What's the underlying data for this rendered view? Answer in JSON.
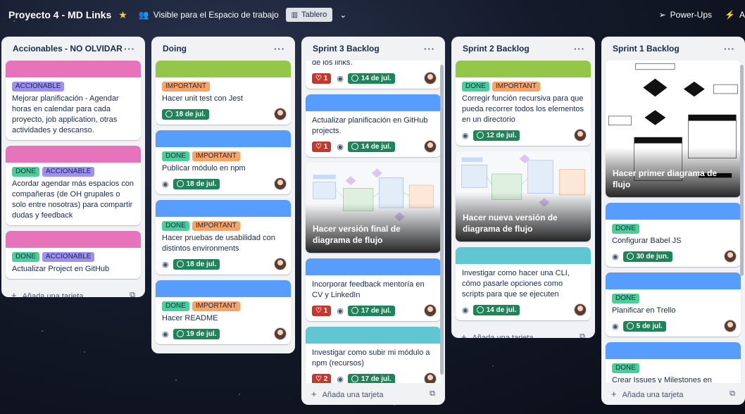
{
  "header": {
    "board_title": "Proyecto 4 - MD Links",
    "visibility": "Visible para el Espacio de trabajo",
    "view": "Tablero",
    "powerups": "Power-Ups",
    "automation": "A"
  },
  "colors": {
    "cover_pink": "#e774bb",
    "cover_green": "#94c748",
    "cover_blue": "#579dff",
    "cover_teal": "#60c6d2",
    "label_green": "#4bce97",
    "label_orange": "#fea362",
    "label_purple": "#9f8fef",
    "due_green": "#1f845a",
    "vote_red": "#c9372c"
  },
  "add_card": "Añada una tarjeta",
  "lists": [
    {
      "title": "Accionables - NO OLVIDAR",
      "cards": [
        {
          "labels": [
            "ACCIONABLE"
          ],
          "title": "Mejorar planificación - Agendar horas en calendar para cada proyecto, job application, otras actividades y descanso."
        },
        {
          "labels": [
            "DONE",
            "ACCIONABLE"
          ],
          "title": "Acordar agendar más espacios con compañeras (de OH grupales o solo entre nosotras) para compartir dudas y feedback"
        },
        {
          "labels": [
            "DONE",
            "ACCIONABLE"
          ],
          "title": "Actualizar Project en GitHub"
        }
      ]
    },
    {
      "title": "Doing",
      "cards": [
        {
          "labels": [
            "IMPORTANT"
          ],
          "title": "Hacer unit test con Jest",
          "due": "18 de jul."
        },
        {
          "labels": [
            "DONE",
            "IMPORTANT"
          ],
          "title": "Publicar módulo en npm",
          "due": "18 de jul."
        },
        {
          "labels": [
            "DONE",
            "IMPORTANT"
          ],
          "title": "Hacer pruebas de usabilidad con distintos environments",
          "due": "18 de jul."
        },
        {
          "labels": [
            "DONE",
            "IMPORTANT"
          ],
          "title": "Hacer README",
          "due": "19 de jul."
        }
      ]
    },
    {
      "title": "Sprint 3 Backlog",
      "cards": [
        {
          "title": "de los links.",
          "votes": "1",
          "due": "14 de jul."
        },
        {
          "title": "Actualizar planificación en GitHub projects.",
          "votes": "1",
          "due": "14 de jul."
        },
        {
          "title": "Hacer versión final de diagrama de flujo"
        },
        {
          "title": "Incorporar feedback mentoría en CV y LinkedIn",
          "votes": "1",
          "due": "17 de jul."
        },
        {
          "title": "Investigar como subir mi módulo a npm (recursos)",
          "votes": "2",
          "due": "17 de jul."
        }
      ]
    },
    {
      "title": "Sprint 2 Backlog",
      "cards": [
        {
          "labels": [
            "DONE",
            "IMPORTANT"
          ],
          "title": "Corregir función recursiva para que pueda recorrer todos los elementos en un directorio",
          "due": "12 de jul."
        },
        {
          "title": "Hacer nueva versión de diagrama de flujo"
        },
        {
          "title": "Investigar como hacer una CLI, cómo pasarle opciones como scripts para que se ejecuten",
          "due": "14 de jul."
        }
      ]
    },
    {
      "title": "Sprint 1 Backlog",
      "cards": [
        {
          "title": "Hacer primer diagrama de flujo"
        },
        {
          "labels": [
            "DONE"
          ],
          "title": "Configurar Babel JS",
          "due": "30 de jun."
        },
        {
          "labels": [
            "DONE"
          ],
          "title": "Planificar en Trello",
          "due": "5 de jul."
        },
        {
          "labels": [
            "DONE"
          ],
          "title": "Crear Issues y Milestones en GitHub"
        }
      ]
    }
  ]
}
